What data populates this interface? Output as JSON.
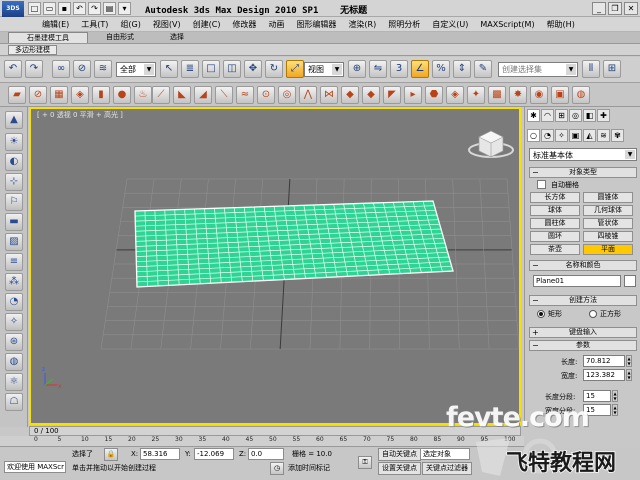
{
  "app": {
    "window_title": "Autodesk 3ds Max Design 2010 SP1    无标题",
    "logo_text": "3DS"
  },
  "menus": [
    "编辑(E)",
    "工具(T)",
    "组(G)",
    "视图(V)",
    "创建(C)",
    "修改器",
    "动画",
    "图形编辑器",
    "渲染(R)",
    "照明分析",
    "自定义(U)",
    "MAXScript(M)",
    "帮助(H)"
  ],
  "ribbon": {
    "tabs": [
      "石墨建模工具",
      "自由形式",
      "选择"
    ],
    "subtab": "多边形建模"
  },
  "toolbar": {
    "selection_filter": "全部",
    "reference_coord": "视图",
    "named_selection_placeholder": "创建选择集"
  },
  "viewport": {
    "label": "[ + 0 透视 0 平滑 + 高光 ]"
  },
  "command_panel": {
    "category": "标准基本体",
    "rollouts": {
      "object_type": "对象类型",
      "name_color": "名称和颜色",
      "creation_method": "创建方法",
      "keyboard_entry": "键盘输入",
      "parameters": "参数"
    },
    "autogrid_label": "自动栅格",
    "object_buttons": [
      "长方体",
      "圆锥体",
      "球体",
      "几何球体",
      "圆柱体",
      "管状体",
      "圆环",
      "四棱锥",
      "茶壶",
      "平面"
    ],
    "active_object": "平面",
    "object_name": "Plane01",
    "creation_options": [
      "矩形",
      "正方形"
    ],
    "length_label": "长度:",
    "length_value": "70.812",
    "width_label": "宽度:",
    "width_value": "123.382",
    "length_segs_label": "长度分段:",
    "length_segs_value": "15",
    "width_segs_label": "宽度分段:",
    "width_segs_value": "15"
  },
  "timeline": {
    "slider": "0 / 100",
    "ticks": [
      "0",
      "5",
      "10",
      "15",
      "20",
      "25",
      "30",
      "35",
      "40",
      "45",
      "50",
      "55",
      "60",
      "65",
      "70",
      "75",
      "80",
      "85",
      "90",
      "95",
      "100"
    ]
  },
  "status": {
    "welcome": "欢迎使用 MAXScr",
    "selected": "选择了",
    "prompt": "单击并拖动以开始创建过程",
    "x_label": "X:",
    "x_value": "58.316",
    "y_label": "Y:",
    "y_value": "-12.069",
    "z_label": "Z:",
    "z_value": "0.0",
    "grid": "栅格 = 10.0",
    "add_time_tag": "添加时间标记",
    "auto_key": "自动关键点",
    "set_key": "设置关键点",
    "selected_object": "选定对象",
    "key_filters": "关键点过滤器"
  },
  "watermark": {
    "site": "fevte.com",
    "brand": "飞特教程网"
  },
  "colors": {
    "plane_fill": "#2fd494",
    "viewport_bg": "#7a7a7a",
    "active_border": "#f6e100",
    "active_button": "#ffc800"
  }
}
